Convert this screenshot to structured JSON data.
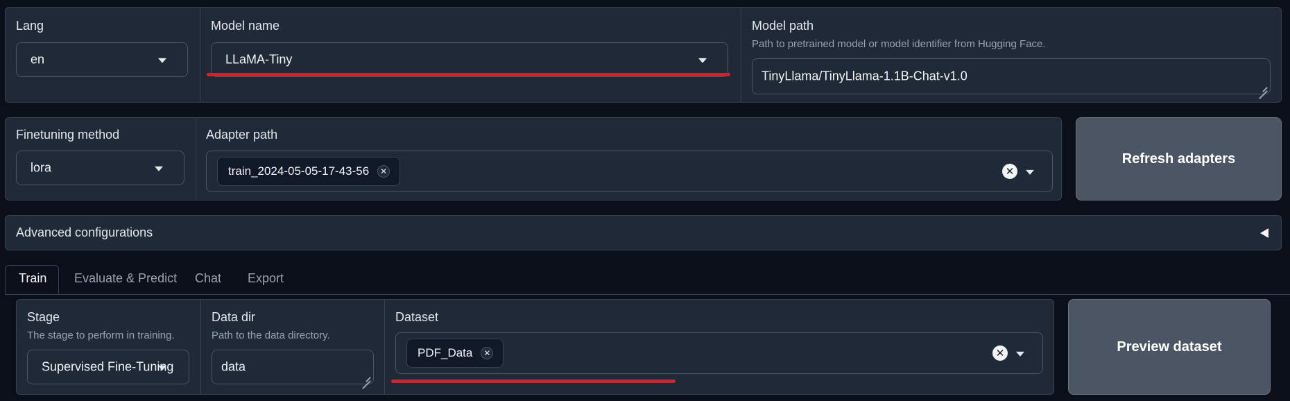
{
  "top_row": {
    "lang": {
      "label": "Lang",
      "value": "en"
    },
    "model_name": {
      "label": "Model name",
      "value": "LLaMA-Tiny"
    },
    "model_path": {
      "label": "Model path",
      "info": "Path to pretrained model or model identifier from Hugging Face.",
      "value": "TinyLlama/TinyLlama-1.1B-Chat-v1.0"
    }
  },
  "second_row": {
    "finetuning_method": {
      "label": "Finetuning method",
      "value": "lora"
    },
    "adapter_path": {
      "label": "Adapter path",
      "chips": [
        "train_2024-05-05-17-43-56"
      ]
    },
    "refresh_button": "Refresh adapters"
  },
  "advanced": {
    "label": "Advanced configurations",
    "toggle_icon": "triangle-left"
  },
  "tabs": [
    {
      "label": "Train",
      "active": true
    },
    {
      "label": "Evaluate & Predict",
      "active": false
    },
    {
      "label": "Chat",
      "active": false
    },
    {
      "label": "Export",
      "active": false
    }
  ],
  "train": {
    "stage": {
      "label": "Stage",
      "info": "The stage to perform in training.",
      "value": "Supervised Fine-Tuning"
    },
    "data_dir": {
      "label": "Data dir",
      "info": "Path to the data directory.",
      "value": "data"
    },
    "dataset": {
      "label": "Dataset",
      "chips": [
        "PDF_Data"
      ]
    },
    "preview_button": "Preview dataset"
  },
  "colors": {
    "background": "#0b0f19",
    "panel": "#1f2937",
    "border": "#374151",
    "annotation_red": "#e11d24",
    "button": "#4b5563"
  }
}
